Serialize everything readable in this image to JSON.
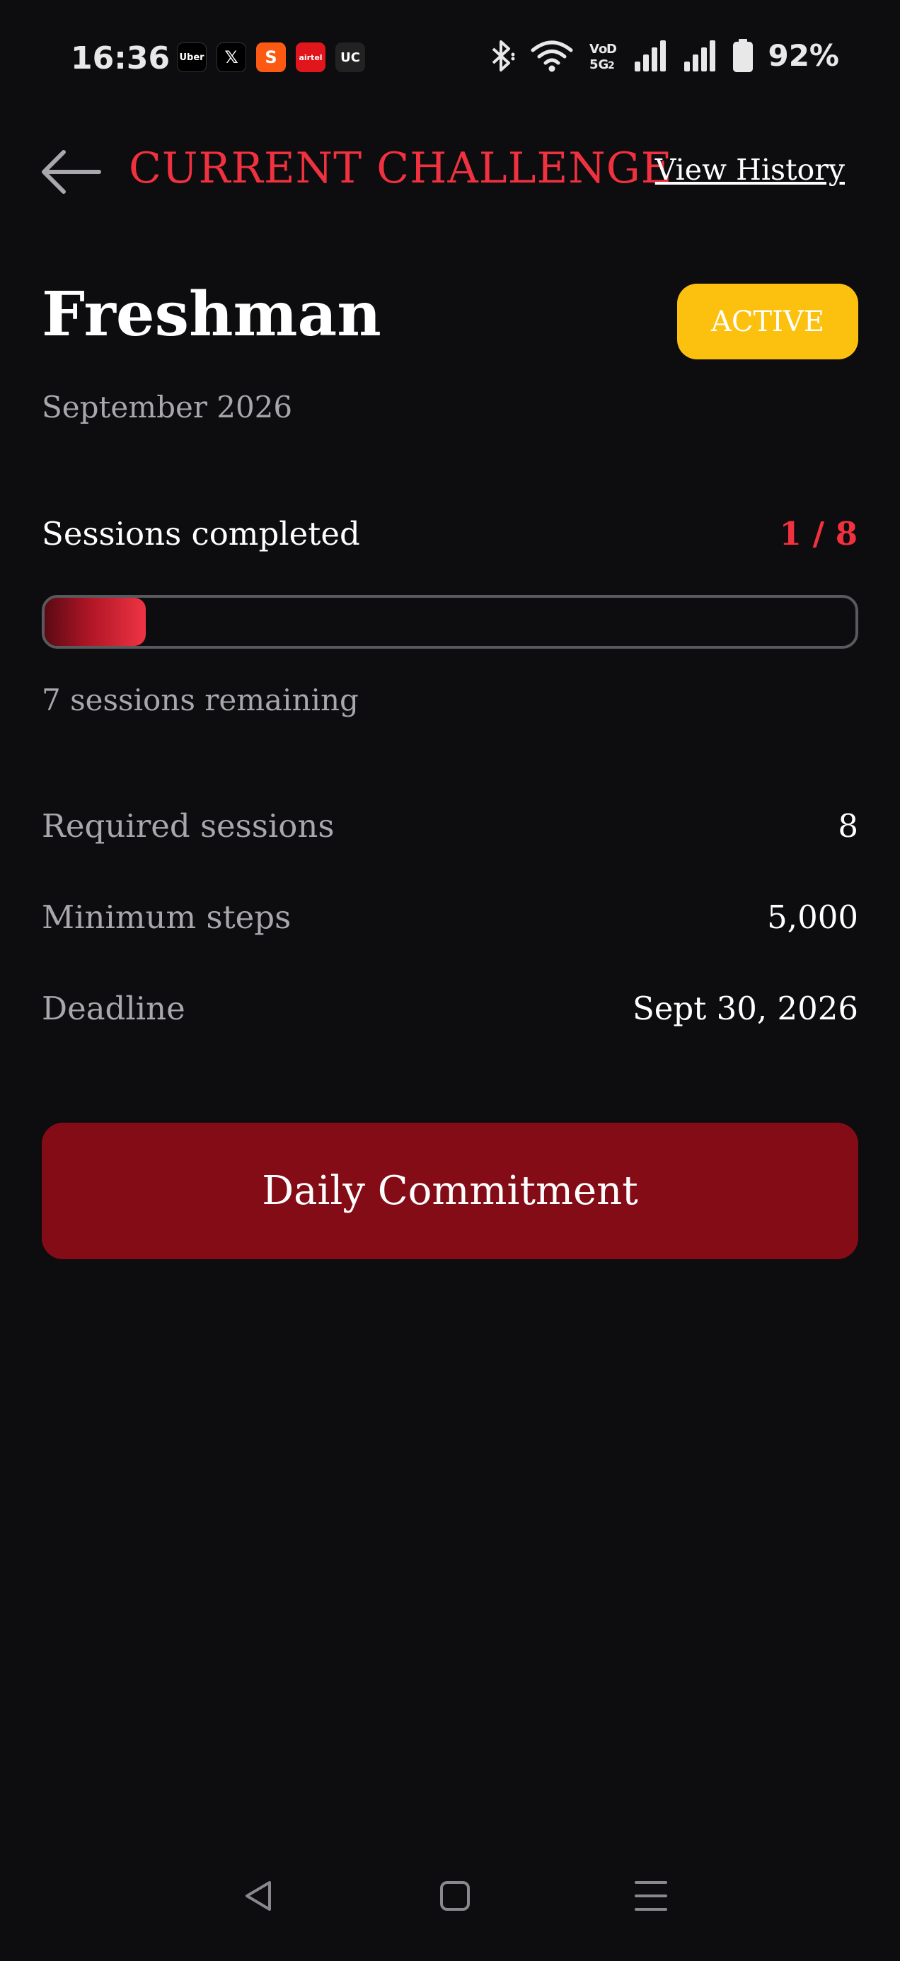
{
  "status_bar": {
    "time": "16:36",
    "notifications": [
      {
        "icon": "uber-icon",
        "label": "Uber"
      },
      {
        "icon": "x-icon",
        "label": "𝕏"
      },
      {
        "icon": "swiggy-icon",
        "label": "S"
      },
      {
        "icon": "airtel-icon",
        "label": "airtel"
      },
      {
        "icon": "uc-icon",
        "label": "UC"
      }
    ],
    "network_label": "Vo LTE 5G",
    "battery": "92%"
  },
  "header": {
    "back_icon": "arrow-left-icon",
    "title": "CURRENT CHALLENGE",
    "view_history": "View History"
  },
  "challenge": {
    "name": "Freshman",
    "status": "ACTIVE",
    "month": "September 2026",
    "sessions_label": "Sessions completed",
    "sessions_count": "1 / 8",
    "progress_fraction": 0.125,
    "remaining": "7 sessions remaining"
  },
  "details": [
    {
      "label": "Required sessions",
      "value": "8"
    },
    {
      "label": "Minimum steps",
      "value": "5,000"
    },
    {
      "label": "Deadline",
      "value": "Sept 30, 2026"
    }
  ],
  "action_button": "Daily Commitment",
  "colors": {
    "background": "#0d0c0f",
    "accent_red": "#f0313f",
    "badge_yellow": "#fcc10f",
    "button_red": "#840c16",
    "muted_text": "#a9a7ac"
  },
  "nav": [
    "back-triangle-icon",
    "home-square-icon",
    "recents-menu-icon"
  ]
}
